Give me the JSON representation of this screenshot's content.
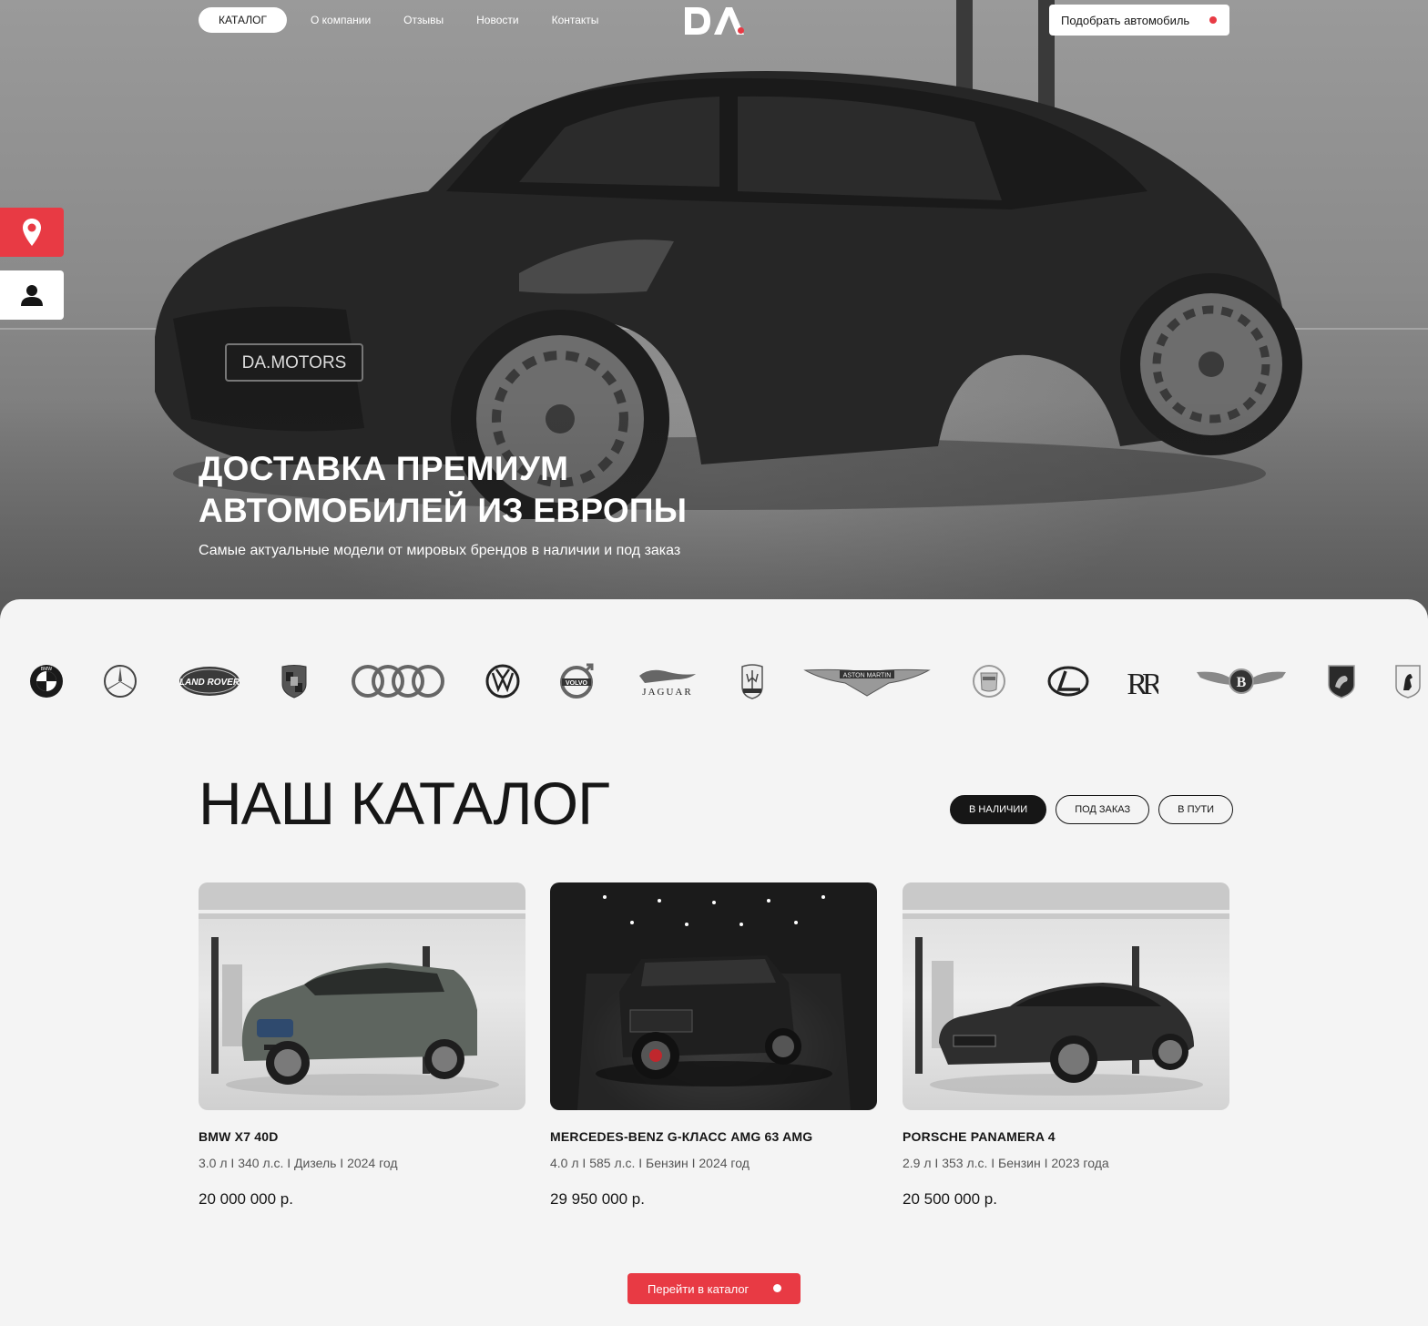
{
  "header": {
    "nav": [
      {
        "label": "КАТАЛОГ"
      },
      {
        "label": "О компании"
      },
      {
        "label": "Отзывы"
      },
      {
        "label": "Новости"
      },
      {
        "label": "Контакты"
      }
    ],
    "logo_text": "DA",
    "pick_button": "Подобрать автомобиль"
  },
  "side": {
    "geo_icon": "map-pin-icon",
    "user_icon": "user-icon"
  },
  "hero": {
    "plate": "DA.MOTORS",
    "title_line1": "ДОСТАВКА ПРЕМИУМ",
    "title_line2": "АВТОМОБИЛЕЙ ИЗ ЕВРОПЫ",
    "subtitle": "Самые актуальные модели от мировых брендов в наличии и под заказ"
  },
  "brands": [
    {
      "name": "BMW",
      "label": "BMW"
    },
    {
      "name": "Mercedes-Benz",
      "label": ""
    },
    {
      "name": "Land Rover",
      "label": "LAND ROVER"
    },
    {
      "name": "Porsche",
      "label": ""
    },
    {
      "name": "Audi",
      "label": ""
    },
    {
      "name": "Volkswagen",
      "label": ""
    },
    {
      "name": "Volvo",
      "label": "VOLVO"
    },
    {
      "name": "Jaguar",
      "label": "JAGUAR"
    },
    {
      "name": "Maserati",
      "label": ""
    },
    {
      "name": "Aston Martin",
      "label": "ASTON MARTIN"
    },
    {
      "name": "Cadillac",
      "label": ""
    },
    {
      "name": "Lexus",
      "label": ""
    },
    {
      "name": "Rolls-Royce",
      "label": "RR"
    },
    {
      "name": "Bentley",
      "label": "B"
    },
    {
      "name": "Lamborghini",
      "label": ""
    },
    {
      "name": "Ferrari",
      "label": ""
    }
  ],
  "catalog": {
    "title": "НАШ КАТАЛОГ",
    "tabs": [
      {
        "label": "В НАЛИЧИИ"
      },
      {
        "label": "ПОД ЗАКАЗ"
      },
      {
        "label": "В ПУТИ"
      }
    ],
    "cards": [
      {
        "name": "BMW X7 40D",
        "spec": "3.0 л I 340 л.с. I Дизель I 2024 год",
        "price": "20 000 000 р."
      },
      {
        "name": "MERCEDES-BENZ G-КЛАСС AMG 63 AMG",
        "spec": "4.0 л I 585 л.с. I Бензин I 2024 год",
        "price": "29 950 000 р."
      },
      {
        "name": "PORSCHE PANAMERA 4",
        "spec": "2.9 л I 353 л.с. I Бензин I 2023 года",
        "price": "20 500 000 р."
      }
    ],
    "go_button": "Перейти в каталог"
  },
  "colors": {
    "accent": "#e83a44",
    "dark": "#161616",
    "background": "#f4f4f4"
  }
}
